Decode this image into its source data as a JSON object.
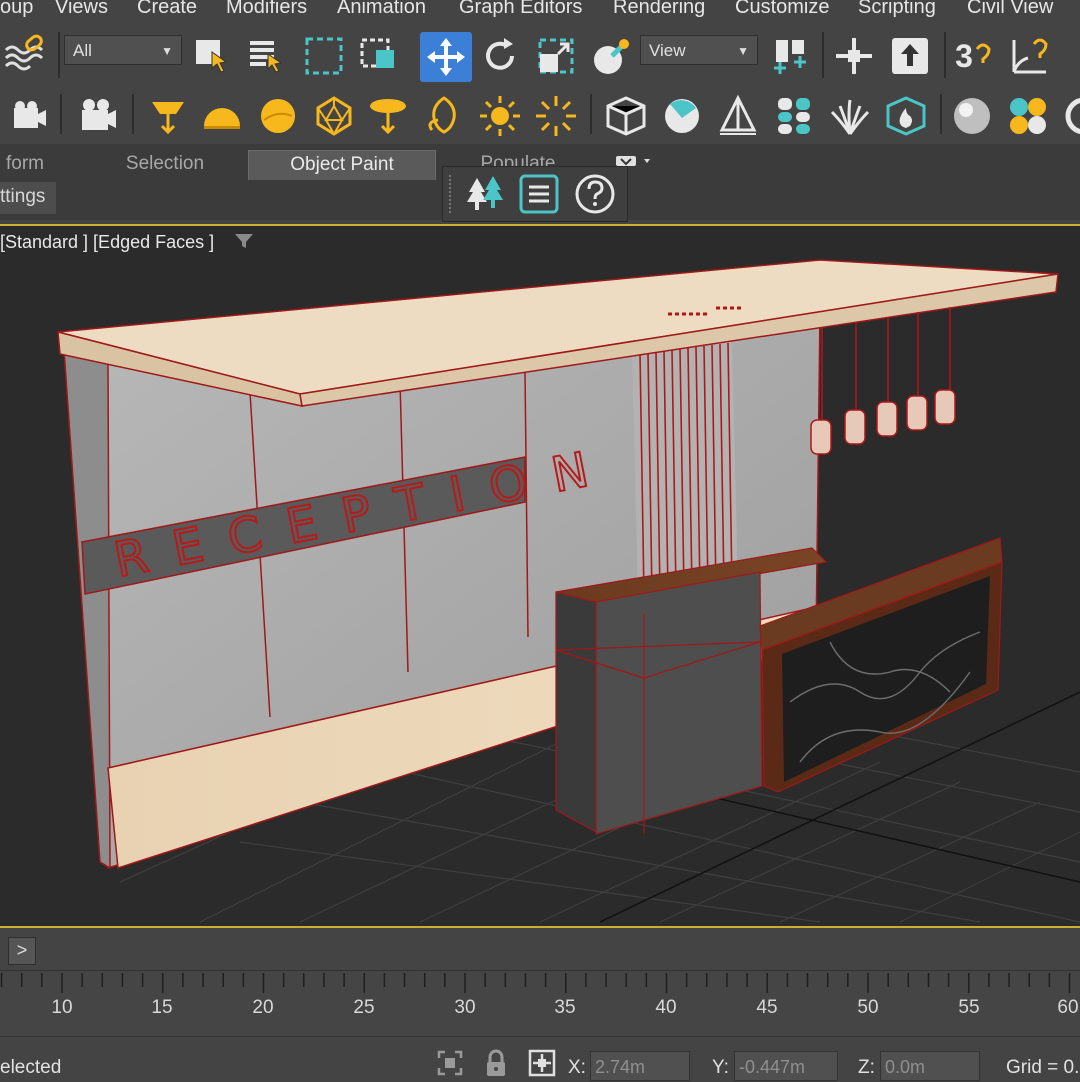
{
  "menu": {
    "items": [
      "oup",
      "Views",
      "Create",
      "Modifiers",
      "Animation",
      "Graph Editors",
      "Rendering",
      "Customize",
      "Scripting",
      "Civil View"
    ]
  },
  "toolbar1": {
    "filter_dropdown": "All",
    "view_dropdown": "View",
    "snap_label": "3"
  },
  "ribbon": {
    "tabs": [
      "form",
      "Selection",
      "Object Paint",
      "Populate"
    ],
    "active_tab": "Object Paint",
    "settings_tab": "ttings"
  },
  "viewport": {
    "label": "[Standard ] [Edged Faces ]",
    "sign_text": "RECEPTION"
  },
  "timeline": {
    "next_button": ">",
    "ticks": [
      "10",
      "15",
      "20",
      "25",
      "30",
      "35",
      "40",
      "45",
      "50",
      "55",
      "60"
    ]
  },
  "status": {
    "selection_text": "elected",
    "x_label": "X:",
    "x_value": "2.74m",
    "y_label": "Y:",
    "y_value": "-0.447m",
    "z_label": "Z:",
    "z_value": "0.0m",
    "grid_text": "Grid = 0."
  },
  "colors": {
    "accent_blue": "#3b7fd6",
    "icon_yellow": "#f6b81c",
    "icon_cyan": "#4cc5c8",
    "viewport_border": "#c9b02f",
    "edge_red": "#b01818"
  }
}
